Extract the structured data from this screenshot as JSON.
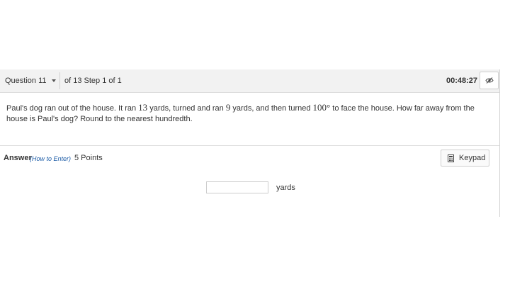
{
  "header": {
    "question_selector": "Question 11",
    "step_text": "of 13 Step 1 of 1",
    "timer": "00:48:27",
    "eye_icon": "eye-slash-icon",
    "caret_icon": "caret-down-icon"
  },
  "question": {
    "part1": "Paul's dog ran out of the house. It ran ",
    "num1": "13",
    "part2": " yards, turned and ran ",
    "num2": "9",
    "part3": " yards, and then turned ",
    "num3": "100°",
    "part4": " to face the house. How far away from the house is Paul's dog? Round to the nearest hundredth."
  },
  "answer": {
    "label": "Answer",
    "how_to_enter": "(How to Enter)",
    "points": "5 Points",
    "keypad_label": "Keypad",
    "keypad_icon": "calculator-icon",
    "input_value": "",
    "unit": "yards"
  },
  "colors": {
    "header_bg": "#f2f2f2",
    "link": "#1f5ea8",
    "border": "#dcdcdc"
  }
}
